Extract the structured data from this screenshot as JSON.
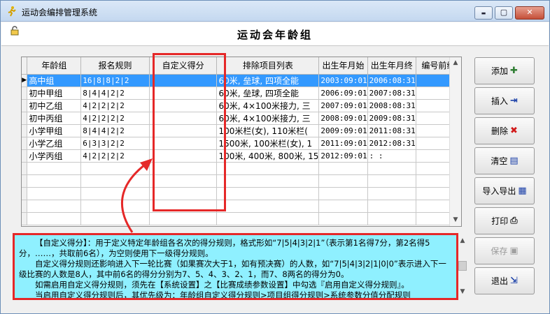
{
  "window": {
    "title": "运动会编排管理系统",
    "minimize_glyph": "▬",
    "maximize_glyph": "▢",
    "close_glyph": "✕"
  },
  "page": {
    "title": "运动会年龄组"
  },
  "grid": {
    "columns": [
      "年龄组",
      "报名规则",
      "自定义得分",
      "排除项目列表",
      "出生年月始",
      "出生年月终",
      "编号前缀"
    ],
    "rows": [
      {
        "group": "高中组",
        "rule": "16|8|8|2|2",
        "custom": "",
        "exclude": "60米, 垒球, 四项全能",
        "start": "2003:09:01",
        "end": "2006:08:31",
        "prefix": ""
      },
      {
        "group": "初中甲组",
        "rule": "8|4|4|2|2",
        "custom": "",
        "exclude": "60米, 垒球, 四项全能",
        "start": "2006:09:01",
        "end": "2007:08:31",
        "prefix": ""
      },
      {
        "group": "初中乙组",
        "rule": "4|2|2|2|2",
        "custom": "",
        "exclude": "60米, 4×100米接力, 三",
        "start": "2007:09:01",
        "end": "2008:08:31",
        "prefix": ""
      },
      {
        "group": "初中丙组",
        "rule": "4|2|2|2|2",
        "custom": "",
        "exclude": "60米, 4×100米接力, 三",
        "start": "2008:09:01",
        "end": "2009:08:31",
        "prefix": ""
      },
      {
        "group": "小学甲组",
        "rule": "8|4|4|2|2",
        "custom": "",
        "exclude": "100米栏(女), 110米栏(",
        "start": "2009:09:01",
        "end": "2011:08:31",
        "prefix": ""
      },
      {
        "group": "小学乙组",
        "rule": "6|3|3|2|2",
        "custom": "",
        "exclude": "1500米, 100米栏(女), 1",
        "start": "2011:09:01",
        "end": "2012:08:31",
        "prefix": ""
      },
      {
        "group": "小学丙组",
        "rule": "4|2|2|2|2",
        "custom": "",
        "exclude": "100米, 400米, 800米, 15",
        "start": "2012:09:01",
        "end": ":    :",
        "prefix": ""
      }
    ],
    "selected_row_marker": "▶",
    "empty_rows": 5
  },
  "buttons": [
    {
      "label": "添加",
      "icon": "add-icon",
      "glyph": "✚",
      "color": "#2e7d32",
      "enabled": true
    },
    {
      "label": "插入",
      "icon": "insert-icon",
      "glyph": "⇥",
      "color": "#1a3fa8",
      "enabled": true
    },
    {
      "label": "删除",
      "icon": "delete-icon",
      "glyph": "✖",
      "color": "#d11a1a",
      "enabled": true
    },
    {
      "label": "清空",
      "icon": "clear-icon",
      "glyph": "▤",
      "color": "#1a3fa8",
      "enabled": true
    },
    {
      "label": "导入导出",
      "icon": "import-export-icon",
      "glyph": "▦",
      "color": "#1a3fa8",
      "enabled": true
    },
    {
      "label": "打印",
      "icon": "printer-icon",
      "glyph": "⎙",
      "color": "#333333",
      "enabled": true
    },
    {
      "label": "保存",
      "icon": "save-icon",
      "glyph": "▣",
      "color": "#a0a0a0",
      "enabled": false
    },
    {
      "label": "退出",
      "icon": "exit-icon",
      "glyph": "⇲",
      "color": "#1a3fa8",
      "enabled": true
    }
  ],
  "info": {
    "lines": [
      "【自定义得分】：用于定义特定年龄组各名次的得分规则，格式形如“7|5|4|3|2|1”（表示第1名得7分，第2名得5分，……，共取前6名），为空则使用下一级得分规则。",
      "自定义得分规则还影响进入下一轮比赛（如果赛次大于1，如有预决赛）的人数，如“7|5|4|3|2|1|0|0”表示进入下一级比赛的人数是8人，其中前6名的得分分别为7、5、4、3、2、1，而7、8两名的得分为0。",
      "如需启用自定义得分规则，须先在【系统设置】之【比赛成绩参数设置】中勾选『启用自定义得分规则』。",
      "当启用自定义得分规则后，其优先级为：年龄组自定义得分规则>项目组得分规则>系统参数分值分配规则"
    ]
  },
  "colors": {
    "highlight": "#e52828",
    "selection": "#3399ff",
    "info_bg": "#8ff0ff"
  }
}
